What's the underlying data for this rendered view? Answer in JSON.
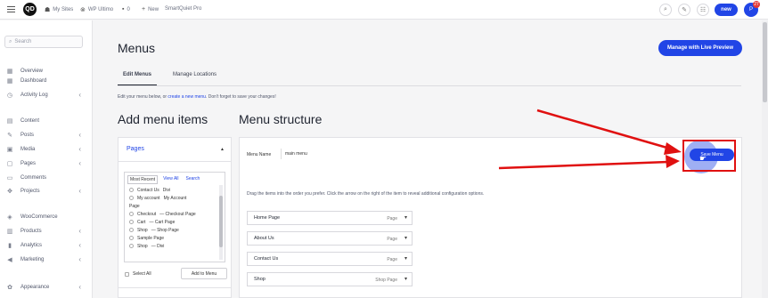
{
  "topbar": {
    "logo_text": "QD",
    "items": [
      {
        "icon": "sites-icon",
        "glyph": "☗",
        "label": "My Sites"
      },
      {
        "icon": "wordpress-icon",
        "glyph": "⊗",
        "label": "WP Ultimo"
      },
      {
        "icon": "comment-icon",
        "glyph": "▪",
        "label": "0"
      },
      {
        "icon": "plus-icon",
        "glyph": "+",
        "label": "New"
      },
      {
        "icon": "",
        "glyph": "",
        "label": "SmartQuiet Pro"
      }
    ],
    "new_label": "new",
    "notification_count": "27"
  },
  "sidebar": {
    "search_placeholder": "Search",
    "items": [
      {
        "label": "Overview",
        "glyph": "▦",
        "has_chevron": false
      },
      {
        "label": "Dashboard",
        "glyph": "▦",
        "has_chevron": false
      },
      {
        "label": "Activity Log",
        "glyph": "◷",
        "has_chevron": true
      },
      {
        "label": "Content",
        "glyph": "▤",
        "has_chevron": false
      },
      {
        "label": "Posts",
        "glyph": "✎",
        "has_chevron": true
      },
      {
        "label": "Media",
        "glyph": "▣",
        "has_chevron": true
      },
      {
        "label": "Pages",
        "glyph": "▢",
        "has_chevron": true
      },
      {
        "label": "Comments",
        "glyph": "▭",
        "has_chevron": false
      },
      {
        "label": "Projects",
        "glyph": "✥",
        "has_chevron": true
      },
      {
        "label": "WooCommerce",
        "glyph": "◈",
        "has_chevron": false
      },
      {
        "label": "Products",
        "glyph": "▥",
        "has_chevron": true
      },
      {
        "label": "Analytics",
        "glyph": "▮",
        "has_chevron": true
      },
      {
        "label": "Marketing",
        "glyph": "◀",
        "has_chevron": true
      },
      {
        "label": "Appearance",
        "glyph": "✿",
        "has_chevron": true
      }
    ]
  },
  "main": {
    "title": "Menus",
    "live_preview_label": "Manage with Live Preview",
    "tabs": [
      {
        "label": "Edit Menus",
        "active": true
      },
      {
        "label": "Manage Locations",
        "active": false
      }
    ],
    "notice_pre": "Edit your menu below, or",
    "notice_link": "create a new menu",
    "notice_post": ". Don't forget to save your changes!",
    "add_items_heading": "Add menu items",
    "structure_heading": "Menu structure"
  },
  "add_panel": {
    "section_title": "Pages",
    "inner_tabs": [
      {
        "label": "Most Recent",
        "active": true
      },
      {
        "label": "View All",
        "active": false
      },
      {
        "label": "Search",
        "active": false
      }
    ],
    "page_items": [
      {
        "label": "Contact Us",
        "tag": "Divi",
        "heading": false
      },
      {
        "label": "My account",
        "tag": "My Account",
        "heading": false
      },
      {
        "label": "Page",
        "tag": "",
        "heading": true
      },
      {
        "label": "Checkout",
        "tag": "— Checkout Page",
        "heading": false
      },
      {
        "label": "Cart",
        "tag": "— Cart Page",
        "heading": false
      },
      {
        "label": "Shop",
        "tag": "— Shop Page",
        "heading": false
      },
      {
        "label": "Sample Page",
        "tag": "",
        "heading": false
      },
      {
        "label": "Shop",
        "tag": "— Divi",
        "heading": false
      }
    ],
    "select_all_label": "Select All",
    "add_to_menu_label": "Add to Menu"
  },
  "structure_panel": {
    "menu_name_label": "Menu Name",
    "menu_name_value": "main menu",
    "save_label": "Save Menu",
    "drag_hint": "Drag the items into the order you prefer. Click the arrow on the right of the item to reveal additional configuration options.",
    "menu_items": [
      {
        "title": "Home Page",
        "type": "Page"
      },
      {
        "title": "About Us",
        "type": "Page"
      },
      {
        "title": "Contact Us",
        "type": "Page"
      },
      {
        "title": "Shop",
        "type": "Shop Page"
      }
    ]
  },
  "colors": {
    "accent": "#2145e6",
    "annotation": "#e01010"
  }
}
